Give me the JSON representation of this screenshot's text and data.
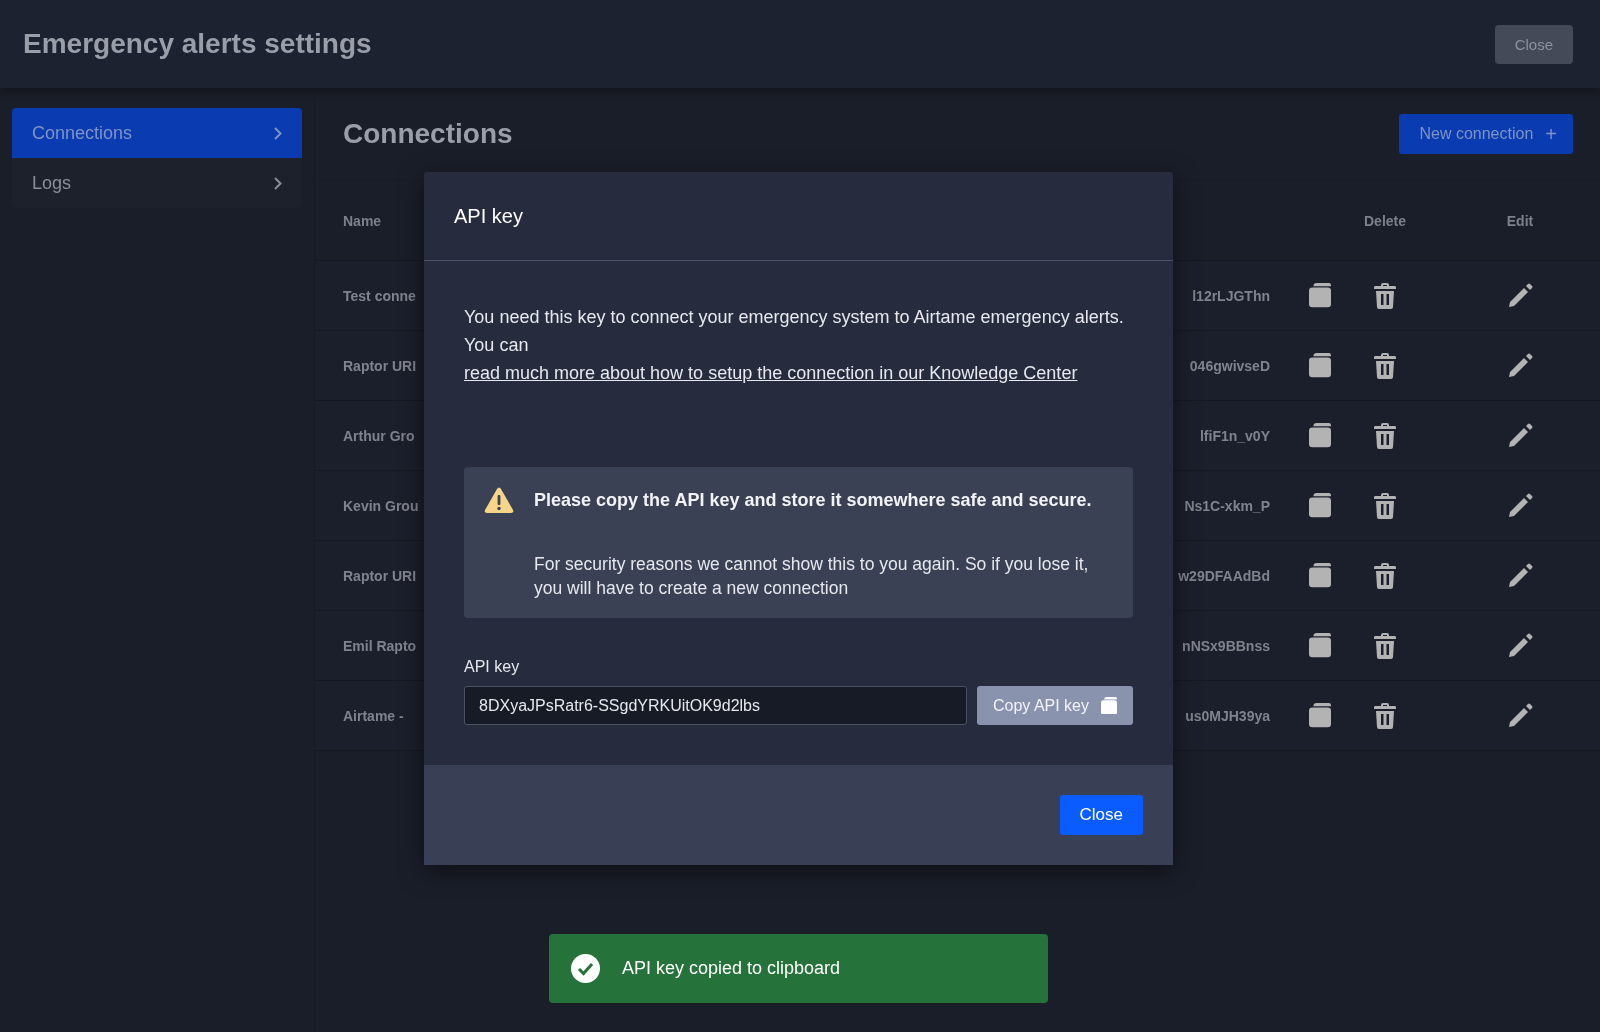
{
  "header": {
    "title": "Emergency alerts settings",
    "close_button": "Close"
  },
  "sidebar": {
    "items": [
      {
        "label": "Connections",
        "selected": true
      },
      {
        "label": "Logs",
        "selected": false
      }
    ]
  },
  "main": {
    "title": "Connections",
    "new_button": "New connection",
    "new_button_icon": "+"
  },
  "table": {
    "columns": [
      "Name",
      "Delete",
      "Edit"
    ],
    "rows": [
      {
        "name": "Test conne",
        "column_2": "l12rLJGThn"
      },
      {
        "name": "Raptor URI",
        "column_2": "046gwivseD"
      },
      {
        "name": "Arthur Gro",
        "column_2": "lfiF1n_v0Y"
      },
      {
        "name": "Kevin Grou",
        "column_2": "Ns1C-xkm_P"
      },
      {
        "name": "Raptor URI",
        "column_2": "w29DFAAdBd"
      },
      {
        "name": "Emil Rapto",
        "column_2": "nNSx9BBnss"
      },
      {
        "name": "Airtame -",
        "column_2": "us0MJH39ya"
      }
    ]
  },
  "dialog": {
    "title": "API key",
    "intro": "You need this key to connect your emergency system to Airtame emergency alerts.",
    "link_prefix": "You can",
    "link": "read much more about how to setup the connection in our Knowledge Center",
    "notice_title": "Please copy the API key and store it somewhere safe and secure.",
    "notice_body": "For security reasons we cannot show this to you again. So if you lose it, you will have to create a new connection",
    "field_label": "API key",
    "field_value": "8DXyaJPsRatr6-SSgdYRKUitOK9d2lbs",
    "copy_button": "Copy API key",
    "close_button": "Close"
  },
  "toast": {
    "message": "API key copied to clipboard"
  }
}
